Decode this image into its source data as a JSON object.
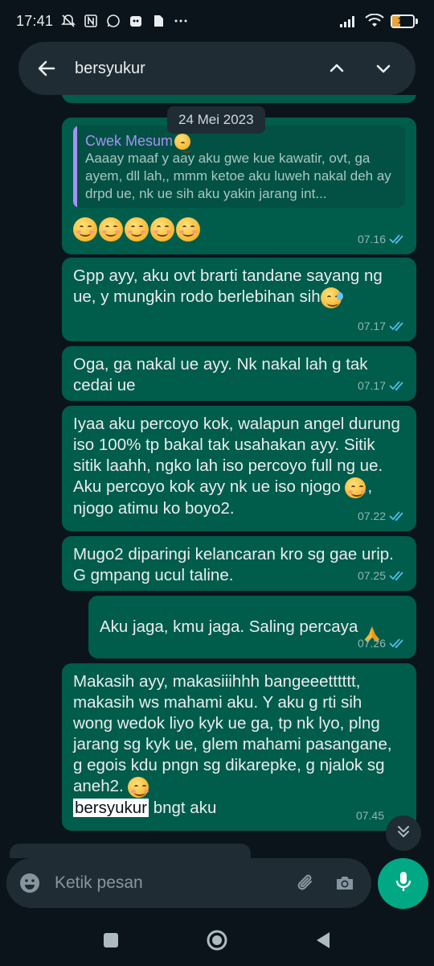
{
  "status_bar": {
    "time": "17:41",
    "battery": "14",
    "battery_color": "#e8a53b"
  },
  "search": {
    "query": "bersyukur",
    "icons": [
      "arrow-left-icon",
      "chevron-up-icon",
      "chevron-down-icon"
    ]
  },
  "date_chip": "24 Mei 2023",
  "messages": [
    {
      "quote_name": "Cwek Mesum",
      "quote_text": "Aaaay maaf y aay aku gwe kue kawatir, ovt, ga ayem, dll lah,, mmm ketoe aku luweh nakal deh ay drpd ue, nk ue sih aku yakin jarang int...",
      "time": "07.16"
    },
    {
      "text": "Gpp ayy, aku ovt brarti tandane sayang ng ue, y mungkin rodo berlebihan sih",
      "time": "07.17"
    },
    {
      "text": "Oga, ga nakal ue ayy. Nk nakal lah g tak cedai ue",
      "time": "07.17"
    },
    {
      "text_a": "Iyaa aku percoyo kok, walapun angel durung iso 100% tp bakal tak usahakan ayy. Sitik sitik laahh, ngko lah iso percoyo full ng ue. Aku percoyo kok ayy nk ue iso njogo ",
      "text_b": ", njogo atimu ko boyo2.",
      "time": "07.22"
    },
    {
      "text": "Mugo2 diparingi kelancaran kro sg gae urip. G gmpang ucul taline.",
      "time": "07.25"
    },
    {
      "text": "Aku jaga, kmu jaga. Saling percaya",
      "time": "07.26"
    },
    {
      "text": "Makasih ayy, makasiiihhh bangeeetttttt, makasih ws mahami aku. Y aku g rti sih wong wedok liyo kyk ue ga, tp nk lyo, plng jarang sg kyk ue, glem mahami pasangane, g egois kdu pngn sg dikarepke, g njalok sg aneh2.",
      "highlight": "bersyukur",
      "text_after": " bngt aku",
      "time": "07.45"
    }
  ],
  "input": {
    "placeholder": "Ketik pesan"
  },
  "colors": {
    "bubble": "#005c4b",
    "accent": "#00a884",
    "tick": "#53bdeb"
  }
}
